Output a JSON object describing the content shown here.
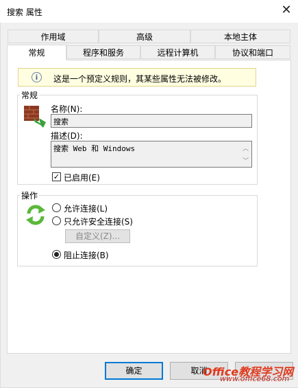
{
  "window": {
    "title": "搜索 属性",
    "close_glyph": "✕"
  },
  "tabs_row1": [
    {
      "label": "作用域"
    },
    {
      "label": "高级"
    },
    {
      "label": "本地主体"
    }
  ],
  "tabs_row2": [
    {
      "label": "常规",
      "active": true
    },
    {
      "label": "程序和服务"
    },
    {
      "label": "远程计算机"
    },
    {
      "label": "协议和端口"
    }
  ],
  "infobar": {
    "text": "这是一个预定义规则，其某些属性无法被修改。",
    "icon": "info-icon"
  },
  "general": {
    "group_label": "常规",
    "icon": "firewall-rule-icon",
    "name_label": "名称(N):",
    "name_value": "搜索",
    "desc_label": "描述(D):",
    "desc_value": "搜索 Web 和 Windows",
    "enabled_label": "已启用(E)",
    "enabled_checked": true
  },
  "action": {
    "group_label": "操作",
    "icon": "refresh-arrows-icon",
    "allow_label": "允许连接(L)",
    "allow_secure_label": "只允许安全连接(S)",
    "custom_label": "自定义(Z)...",
    "block_label": "阻止连接(B)",
    "selected": "block"
  },
  "buttons": {
    "ok": "确定",
    "cancel": "取消"
  },
  "watermark": {
    "brand": "Office教程学习网",
    "url": "www.office68.com"
  }
}
